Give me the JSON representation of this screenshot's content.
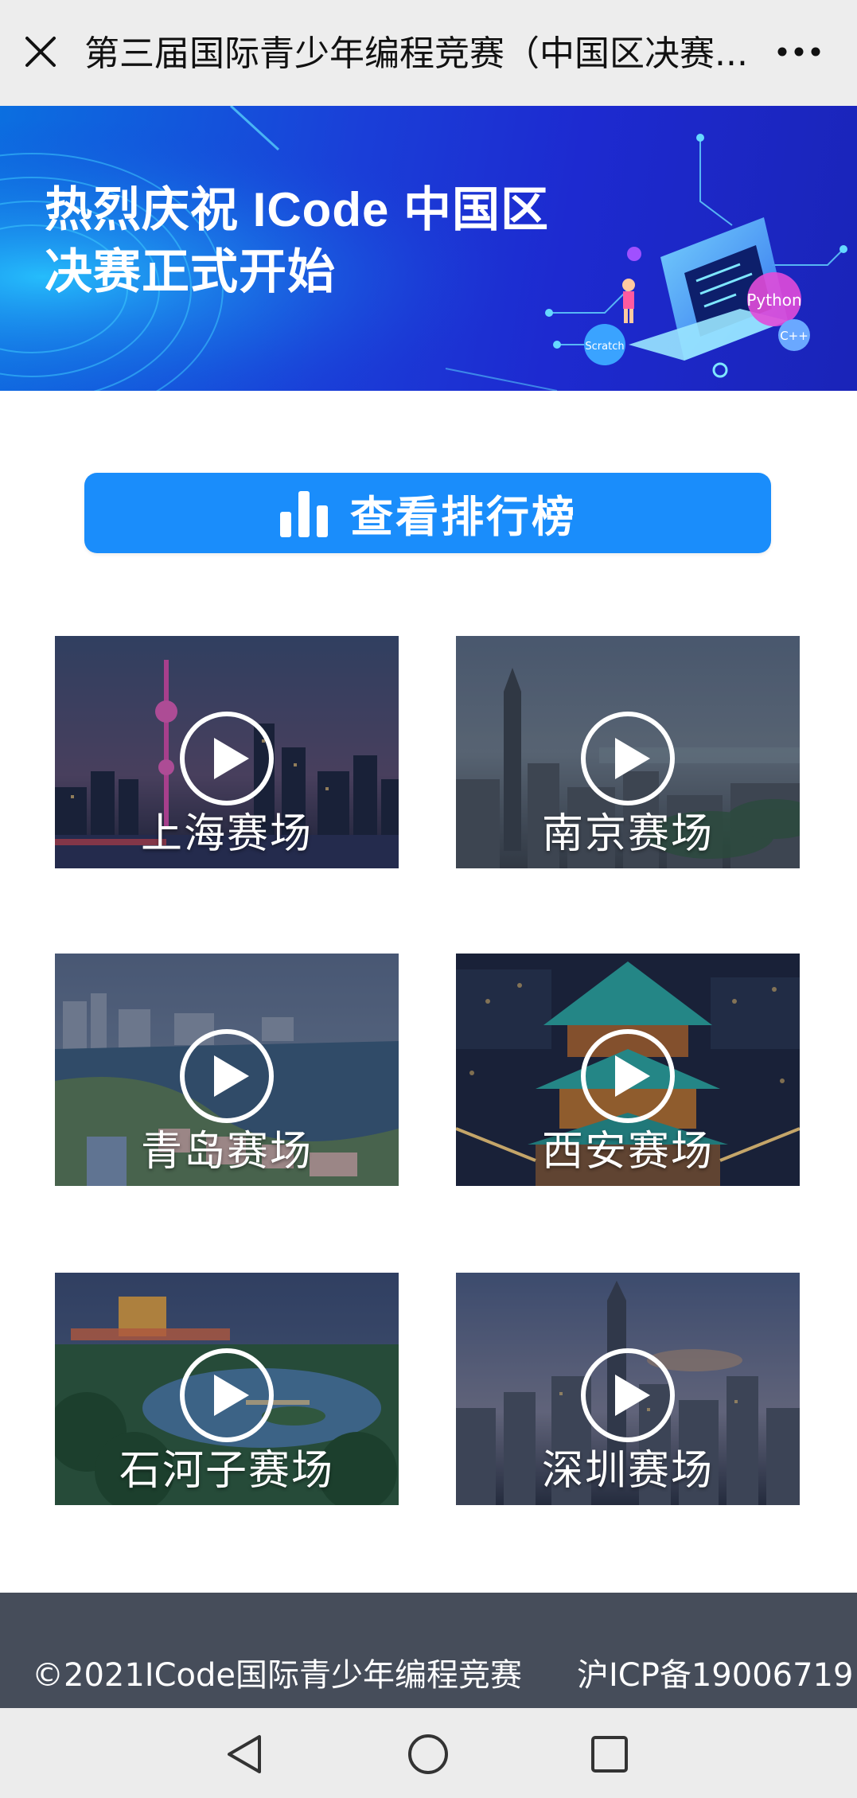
{
  "topbar": {
    "title": "第三届国际青少年编程竞赛（中国区决赛...",
    "close_icon": "close-icon",
    "more_icon": "more-icon"
  },
  "banner": {
    "line1": "热烈庆祝 ICode 中国区",
    "line2": "决赛正式开始",
    "art_labels": [
      "Python",
      "Scratch",
      "C++"
    ]
  },
  "rank_button": {
    "label": "查看排行榜",
    "icon": "bar-chart-icon",
    "color": "#1a8dfb"
  },
  "venues": [
    {
      "label": "上海赛场",
      "icon": "play-icon"
    },
    {
      "label": "南京赛场",
      "icon": "play-icon"
    },
    {
      "label": "青岛赛场",
      "icon": "play-icon"
    },
    {
      "label": "西安赛场",
      "icon": "play-icon"
    },
    {
      "label": "石河子赛场",
      "icon": "play-icon"
    },
    {
      "label": "深圳赛场",
      "icon": "play-icon"
    }
  ],
  "footer": {
    "copyright": "©2021ICode国际青少年编程竞赛",
    "icp": "沪ICP备19006719",
    "background": "#464d5a"
  },
  "system_nav": {
    "back_icon": "back-triangle-icon",
    "home_icon": "home-circle-icon",
    "recents_icon": "recents-square-icon"
  }
}
